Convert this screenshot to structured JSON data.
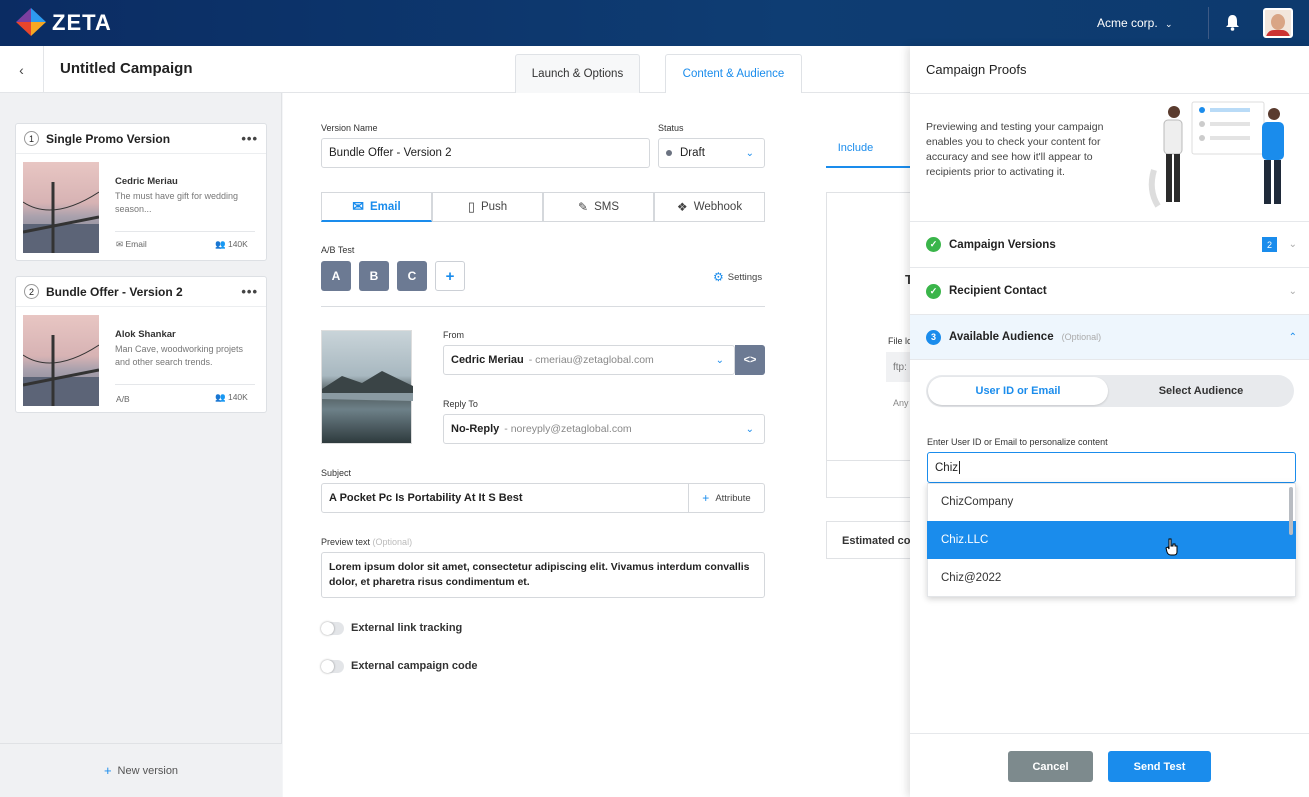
{
  "header": {
    "org_name": "Acme corp.",
    "logo_text": "ZETA"
  },
  "campaign": {
    "title": "Untitled Campaign"
  },
  "tabs": [
    {
      "label": "Launch & Options"
    },
    {
      "label": "Content & Audience"
    }
  ],
  "versions": [
    {
      "num": "1",
      "title": "Single Promo Version",
      "name": "Cedric Meriau",
      "desc": "The must have gift for wedding season...",
      "channel": "Email",
      "count": "140K"
    },
    {
      "num": "2",
      "title": "Bundle Offer - Version 2",
      "name": "Alok Shankar",
      "desc": "Man Cave, woodworking projets and other search trends.",
      "channel": "A/B",
      "count": "140K"
    }
  ],
  "new_version": "New version",
  "form": {
    "version_name_label": "Version Name",
    "version_name_value": "Bundle Offer - Version 2",
    "status_label": "Status",
    "status_value": "Draft",
    "channels": [
      "Email",
      "Push",
      "SMS",
      "Webhook"
    ],
    "ab_label": "A/B Test",
    "ab_options": [
      "A",
      "B",
      "C"
    ],
    "settings_label": "Settings",
    "from_label": "From",
    "from_name": "Cedric Meriau",
    "from_email": "- cmeriau@zetaglobal.com",
    "reply_label": "Reply To",
    "reply_name": "No-Reply",
    "reply_email": "- noreyply@zetaglobal.com",
    "subject_label": "Subject",
    "subject_value": "A Pocket Pc Is Portability At It S Best",
    "attribute_label": "Attribute",
    "preview_label": "Preview text",
    "preview_optional": "(Optional)",
    "preview_value": "Lorem ipsum dolor sit amet, consectetur adipiscing elit. Vivamus interdum convallis dolor, et pharetra risus condimentum et.",
    "toggle1": "External link tracking",
    "toggle2": "External campaign code"
  },
  "background_panel": {
    "include_tab": "Include",
    "file_label": "File lo",
    "ftp_text": "ftp:",
    "any_text": "Any",
    "t_text": "T",
    "estimated": "Estimated cou"
  },
  "proofs": {
    "title": "Campaign Proofs",
    "intro": "Previewing and testing your campaign enables you to check your content for accuracy and see how it'll appear to recipients prior to activating it.",
    "sections": [
      {
        "label": "Campaign Versions",
        "badge": "2"
      },
      {
        "label": "Recipient Contact"
      },
      {
        "label": "Available Audience",
        "optional": "(Optional)",
        "num": "3"
      }
    ],
    "toggle_options": [
      "User ID or Email",
      "Select Audience"
    ],
    "search_label": "Enter User ID or Email to personalize content",
    "search_value": "Chiz",
    "suggestions": [
      "ChizCompany",
      "Chiz.LLC",
      "Chiz@2022"
    ],
    "cancel": "Cancel",
    "send": "Send Test"
  },
  "colors": {
    "accent": "#1a8cec",
    "topbar": "#0b2c63",
    "success": "#3ab54a",
    "ab_button": "#6c7a93"
  }
}
